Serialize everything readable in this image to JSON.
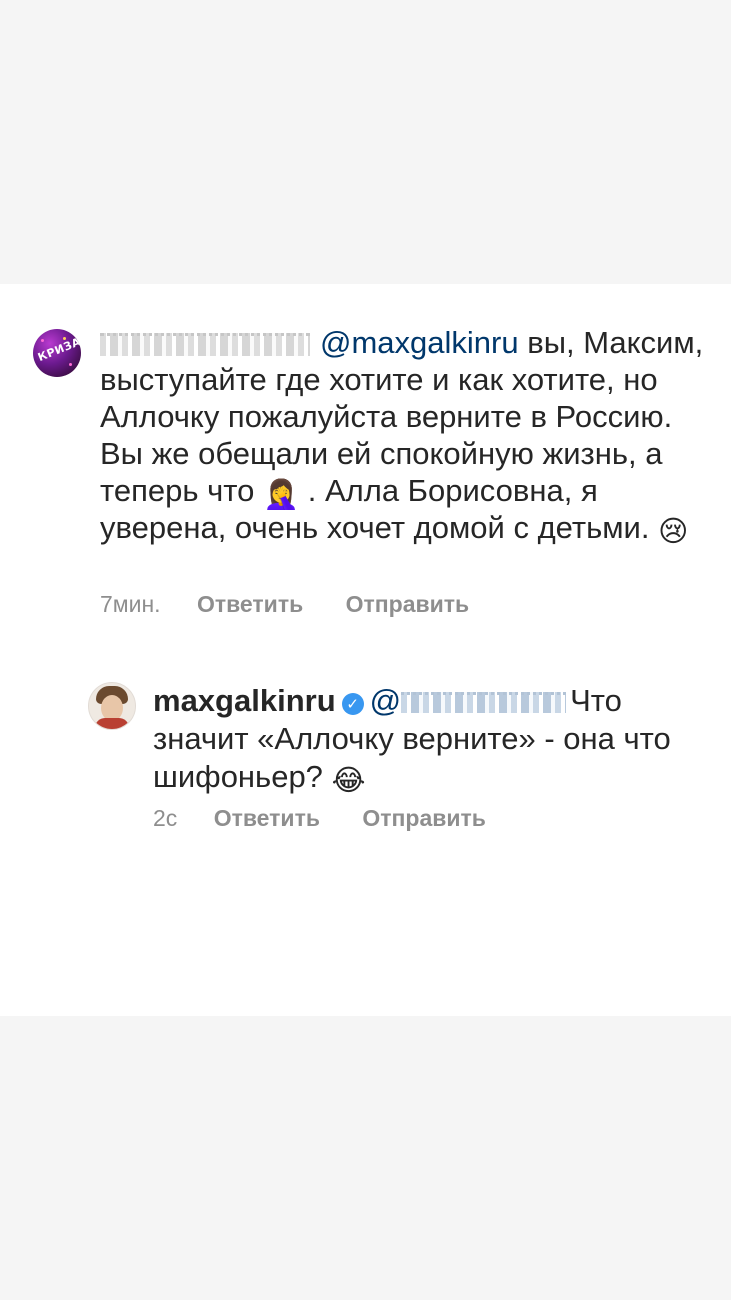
{
  "comment": {
    "avatar_text": "КРИЗА",
    "mention": "@maxgalkinru",
    "text_after_mention": "вы, Максим, выступайте где хотите и как хотите, но Аллочку пожалуйста верните в Россию. Вы же обещали ей спокойную жизнь, а теперь что",
    "emoji_facepalm": "🤦‍♀️",
    "text_after_emoji": ". Алла Борисовна, я уверена, очень хочет домой с детьми.",
    "emoji_cry": "😢",
    "time": "7мин.",
    "reply_label": "Ответить",
    "send_label": "Отправить"
  },
  "reply": {
    "username": "maxgalkinru",
    "verified_icon": "✓",
    "mention_prefix": "@",
    "text": "Что значит «Аллочку верните» - она что шифоньер?",
    "emoji_laugh": "😂",
    "time": "2с",
    "reply_label": "Ответить",
    "send_label": "Отправить"
  },
  "colors": {
    "background_band": "#f5f5f5",
    "card": "#ffffff",
    "text": "#262626",
    "mention": "#00376b",
    "meta": "#8e8e8e",
    "verified": "#3897f0"
  }
}
